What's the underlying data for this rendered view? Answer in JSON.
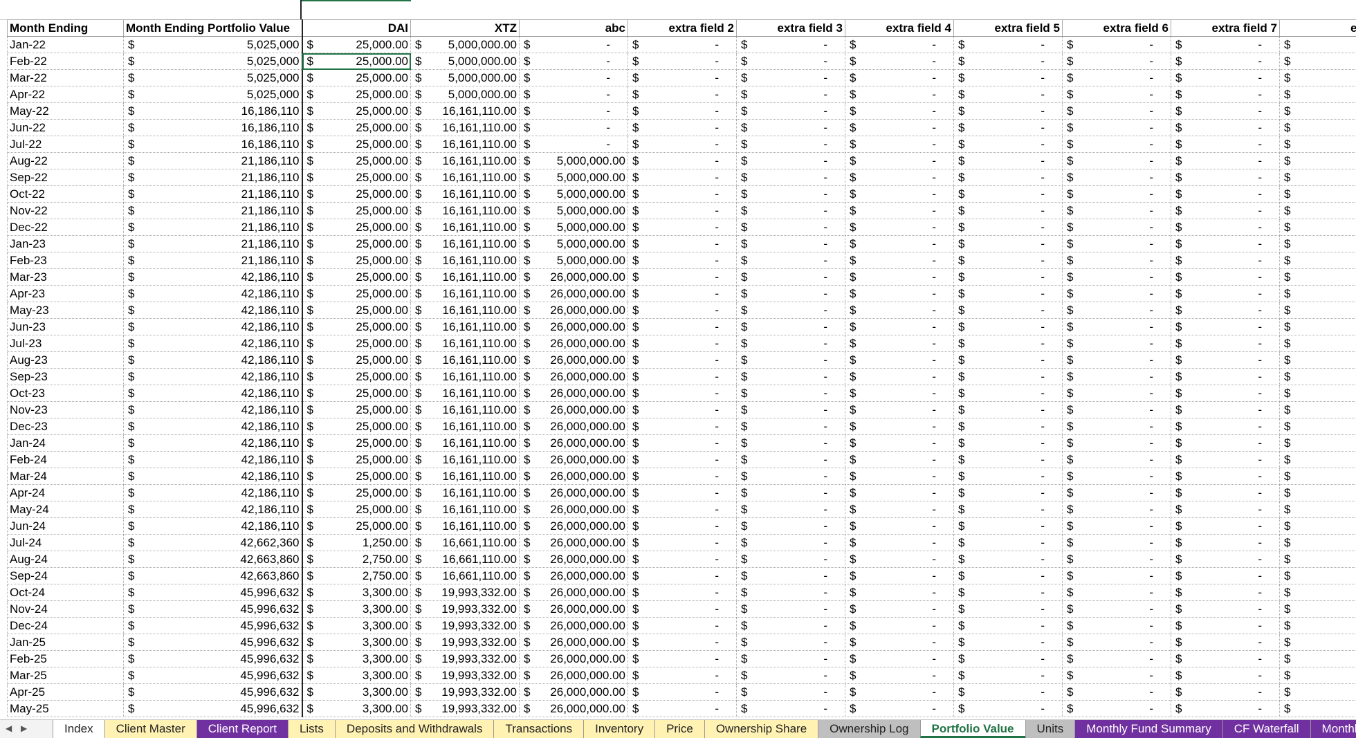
{
  "sheet": {
    "headers": [
      "Month Ending",
      "Month Ending Portfolio Value",
      "DAI",
      "XTZ",
      "abc",
      "extra field 2",
      "extra field 3",
      "extra field 4",
      "extra field 5",
      "extra field 6",
      "extra field 7",
      "extra f"
    ],
    "currency_symbol": "$",
    "dash": "-",
    "rows": [
      [
        "Jan-22",
        "5,025,000",
        "25,000.00",
        "5,000,000.00",
        "-"
      ],
      [
        "Feb-22",
        "5,025,000",
        "25,000.00",
        "5,000,000.00",
        "-"
      ],
      [
        "Mar-22",
        "5,025,000",
        "25,000.00",
        "5,000,000.00",
        "-"
      ],
      [
        "Apr-22",
        "5,025,000",
        "25,000.00",
        "5,000,000.00",
        "-"
      ],
      [
        "May-22",
        "16,186,110",
        "25,000.00",
        "16,161,110.00",
        "-"
      ],
      [
        "Jun-22",
        "16,186,110",
        "25,000.00",
        "16,161,110.00",
        "-"
      ],
      [
        "Jul-22",
        "16,186,110",
        "25,000.00",
        "16,161,110.00",
        "-"
      ],
      [
        "Aug-22",
        "21,186,110",
        "25,000.00",
        "16,161,110.00",
        "5,000,000.00"
      ],
      [
        "Sep-22",
        "21,186,110",
        "25,000.00",
        "16,161,110.00",
        "5,000,000.00"
      ],
      [
        "Oct-22",
        "21,186,110",
        "25,000.00",
        "16,161,110.00",
        "5,000,000.00"
      ],
      [
        "Nov-22",
        "21,186,110",
        "25,000.00",
        "16,161,110.00",
        "5,000,000.00"
      ],
      [
        "Dec-22",
        "21,186,110",
        "25,000.00",
        "16,161,110.00",
        "5,000,000.00"
      ],
      [
        "Jan-23",
        "21,186,110",
        "25,000.00",
        "16,161,110.00",
        "5,000,000.00"
      ],
      [
        "Feb-23",
        "21,186,110",
        "25,000.00",
        "16,161,110.00",
        "5,000,000.00"
      ],
      [
        "Mar-23",
        "42,186,110",
        "25,000.00",
        "16,161,110.00",
        "26,000,000.00"
      ],
      [
        "Apr-23",
        "42,186,110",
        "25,000.00",
        "16,161,110.00",
        "26,000,000.00"
      ],
      [
        "May-23",
        "42,186,110",
        "25,000.00",
        "16,161,110.00",
        "26,000,000.00"
      ],
      [
        "Jun-23",
        "42,186,110",
        "25,000.00",
        "16,161,110.00",
        "26,000,000.00"
      ],
      [
        "Jul-23",
        "42,186,110",
        "25,000.00",
        "16,161,110.00",
        "26,000,000.00"
      ],
      [
        "Aug-23",
        "42,186,110",
        "25,000.00",
        "16,161,110.00",
        "26,000,000.00"
      ],
      [
        "Sep-23",
        "42,186,110",
        "25,000.00",
        "16,161,110.00",
        "26,000,000.00"
      ],
      [
        "Oct-23",
        "42,186,110",
        "25,000.00",
        "16,161,110.00",
        "26,000,000.00"
      ],
      [
        "Nov-23",
        "42,186,110",
        "25,000.00",
        "16,161,110.00",
        "26,000,000.00"
      ],
      [
        "Dec-23",
        "42,186,110",
        "25,000.00",
        "16,161,110.00",
        "26,000,000.00"
      ],
      [
        "Jan-24",
        "42,186,110",
        "25,000.00",
        "16,161,110.00",
        "26,000,000.00"
      ],
      [
        "Feb-24",
        "42,186,110",
        "25,000.00",
        "16,161,110.00",
        "26,000,000.00"
      ],
      [
        "Mar-24",
        "42,186,110",
        "25,000.00",
        "16,161,110.00",
        "26,000,000.00"
      ],
      [
        "Apr-24",
        "42,186,110",
        "25,000.00",
        "16,161,110.00",
        "26,000,000.00"
      ],
      [
        "May-24",
        "42,186,110",
        "25,000.00",
        "16,161,110.00",
        "26,000,000.00"
      ],
      [
        "Jun-24",
        "42,186,110",
        "25,000.00",
        "16,161,110.00",
        "26,000,000.00"
      ],
      [
        "Jul-24",
        "42,662,360",
        "1,250.00",
        "16,661,110.00",
        "26,000,000.00"
      ],
      [
        "Aug-24",
        "42,663,860",
        "2,750.00",
        "16,661,110.00",
        "26,000,000.00"
      ],
      [
        "Sep-24",
        "42,663,860",
        "2,750.00",
        "16,661,110.00",
        "26,000,000.00"
      ],
      [
        "Oct-24",
        "45,996,632",
        "3,300.00",
        "19,993,332.00",
        "26,000,000.00"
      ],
      [
        "Nov-24",
        "45,996,632",
        "3,300.00",
        "19,993,332.00",
        "26,000,000.00"
      ],
      [
        "Dec-24",
        "45,996,632",
        "3,300.00",
        "19,993,332.00",
        "26,000,000.00"
      ],
      [
        "Jan-25",
        "45,996,632",
        "3,300.00",
        "19,993,332.00",
        "26,000,000.00"
      ],
      [
        "Feb-25",
        "45,996,632",
        "3,300.00",
        "19,993,332.00",
        "26,000,000.00"
      ],
      [
        "Mar-25",
        "45,996,632",
        "3,300.00",
        "19,993,332.00",
        "26,000,000.00"
      ],
      [
        "Apr-25",
        "45,996,632",
        "3,300.00",
        "19,993,332.00",
        "26,000,000.00"
      ],
      [
        "May-25",
        "45,996,632",
        "3,300.00",
        "19,993,332.00",
        "26,000,000.00"
      ]
    ],
    "active_cell": {
      "row": 1,
      "col": 2
    }
  },
  "tabbar": {
    "tabs": [
      {
        "label": "Index",
        "style": "plain"
      },
      {
        "label": "Client Master",
        "style": "yellow"
      },
      {
        "label": "Client Report",
        "style": "purple"
      },
      {
        "label": "Lists",
        "style": "yellow"
      },
      {
        "label": "Deposits and Withdrawals",
        "style": "yellow"
      },
      {
        "label": "Transactions",
        "style": "yellow"
      },
      {
        "label": "Inventory",
        "style": "yellow"
      },
      {
        "label": "Price",
        "style": "yellow"
      },
      {
        "label": "Ownership Share",
        "style": "yellow"
      },
      {
        "label": "Ownership Log",
        "style": "gray"
      },
      {
        "label": "Portfolio Value",
        "style": "active"
      },
      {
        "label": "Units",
        "style": "gray"
      },
      {
        "label": "Monthly Fund Summary",
        "style": "purple"
      },
      {
        "label": "CF Waterfall",
        "style": "purple"
      },
      {
        "label": "Monthly Dist",
        "style": "purple"
      }
    ],
    "icons": [
      "scroll-left-icon",
      "scroll-right-icon"
    ]
  },
  "colors": {
    "accent": "#217346",
    "tab_yellow": "#fff2b3",
    "tab_purple": "#7030a0",
    "tab_gray": "#bfbfbf"
  }
}
